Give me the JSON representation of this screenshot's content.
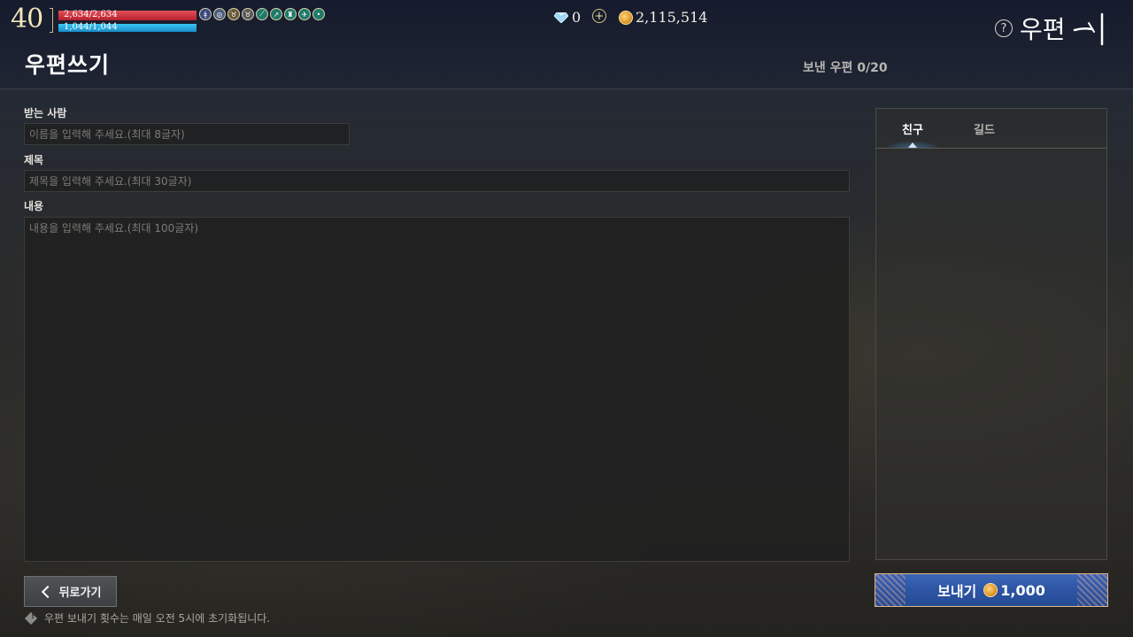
{
  "hud": {
    "level": "40",
    "hp_text": "2,634/2,634",
    "hp_fraction": 1.0,
    "mp_text": "1,044/1,044",
    "mp_fraction": 1.0,
    "buffs": [
      "buff-icon-1",
      "buff-icon-2",
      "buff-icon-3",
      "buff-icon-4",
      "buff-icon-5",
      "buff-icon-6",
      "buff-icon-7",
      "buff-icon-8",
      "buff-icon-9"
    ],
    "diamonds": "0",
    "gold": "2,115,514"
  },
  "menu": {
    "title": "우편",
    "help_glyph": "?"
  },
  "page": {
    "title": "우편쓰기",
    "sent_count": "보낸 우편 0/20"
  },
  "form": {
    "recipient_label": "받는 사람",
    "recipient_placeholder": "이름을 입력해 주세요.(최대 8글자)",
    "subject_label": "제목",
    "subject_placeholder": "제목을 입력해 주세요.(최대 30글자)",
    "body_label": "내용",
    "body_placeholder": "내용을 입력해 주세요.(최대 100글자)"
  },
  "side_panel": {
    "tabs": [
      {
        "label": "친구",
        "active": true
      },
      {
        "label": "길드",
        "active": false
      }
    ]
  },
  "actions": {
    "back_label": "뒤로가기",
    "send_label": "보내기",
    "send_cost": "1,000"
  },
  "notice": "우편 보내기 횟수는 매일 오전 5시에 초기화됩니다.",
  "colors": {
    "hp": "#d8323f",
    "mp": "#2aa8e0",
    "send_button": "#2d55a3",
    "gold_coin": "#e0a030"
  }
}
